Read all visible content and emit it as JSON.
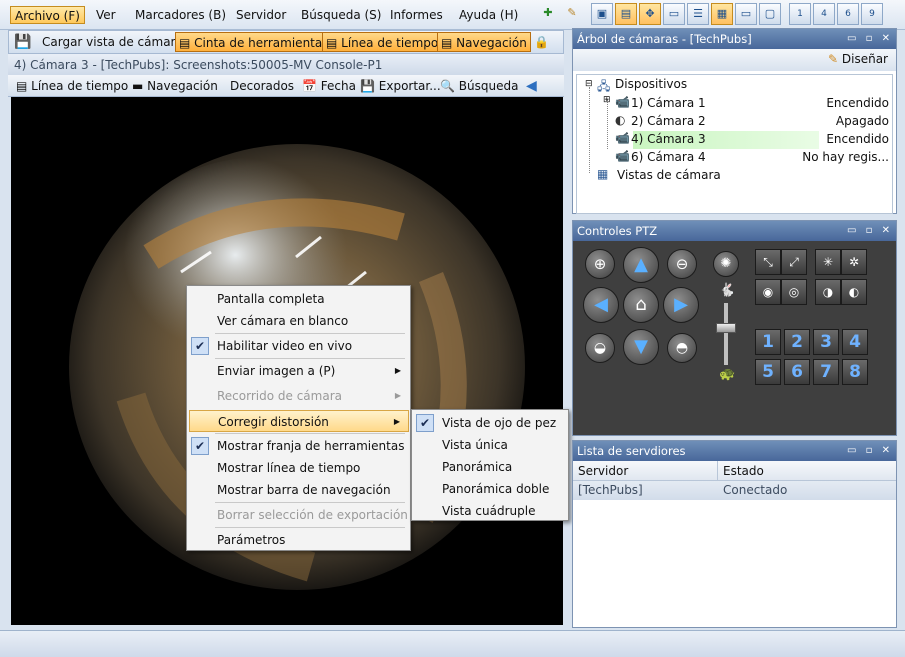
{
  "menubar": {
    "items": [
      "Archivo (F)",
      "Ver",
      "Marcadores (B)",
      "Servidor",
      "Búsqueda (S)",
      "Informes",
      "Ayuda (H)"
    ]
  },
  "toolbar_icons": [
    "add-icon",
    "edit-icon",
    "monitor-icon",
    "layout-grid-icon",
    "move-icon",
    "window-icon",
    "list-icon",
    "layout-active-icon",
    "window-2-icon",
    "window-3-icon",
    "layout-1-icon",
    "layout-4-icon",
    "layout-6-icon",
    "layout-9-icon"
  ],
  "toolbar": {
    "load_view": "Cargar vista de cámara",
    "strip": "Cinta de herramientas",
    "timeline": "Línea de tiempo",
    "navigation": "Navegación"
  },
  "camera_view": {
    "title": "4) Cámara 3 - [TechPubs]: Screenshots:50005-MV Console-P1",
    "toolbar": {
      "timeline": "Línea de tiempo",
      "navigation": "Navegación",
      "decorated": "Decorados",
      "date": "Fecha",
      "export": "Exportar...",
      "search": "Búsqueda"
    }
  },
  "context_menu": {
    "items": [
      {
        "label": "Pantalla completa"
      },
      {
        "label": "Ver cámara en blanco"
      },
      {
        "label": "Habilitar video en vivo"
      },
      {
        "label": "Enviar imagen a (P)"
      },
      {
        "label": "Recorrido de cámara"
      },
      {
        "label": "Corregir distorsión"
      },
      {
        "label": "Mostrar franja de herramientas"
      },
      {
        "label": "Mostrar línea de tiempo"
      },
      {
        "label": "Mostrar barra de navegación"
      },
      {
        "label": "Borrar selección de exportación"
      },
      {
        "label": "Parámetros"
      }
    ]
  },
  "submenu": {
    "items": [
      {
        "label": "Vista de ojo de pez"
      },
      {
        "label": "Vista única"
      },
      {
        "label": "Panorámica"
      },
      {
        "label": "Panorámica doble"
      },
      {
        "label": "Vista cuádruple"
      }
    ]
  },
  "camera_tree": {
    "title": "Árbol de cámaras - [TechPubs]",
    "design_button": "Diseñar",
    "root": "Dispositivos",
    "cameras": [
      {
        "name": "1) Cámara 1",
        "status": "Encendido"
      },
      {
        "name": "2) Cámara 2",
        "status": "Apagado"
      },
      {
        "name": "4) Cámara 3",
        "status": "Encendido"
      },
      {
        "name": "6) Cámara 4",
        "status": "No hay regis..."
      }
    ],
    "views": "Vistas de cámara"
  },
  "ptz": {
    "title": "Controles PTZ",
    "presets": [
      "1",
      "2",
      "3",
      "4",
      "5",
      "6",
      "7",
      "8"
    ]
  },
  "servers": {
    "title": "Lista de servdiores",
    "columns": [
      "Servidor",
      "Estado"
    ],
    "rows": [
      {
        "server": "[TechPubs]",
        "status": "Conectado"
      }
    ]
  },
  "colors": {
    "accent": "#ffc95c",
    "panel_header": "#48679a",
    "selected_row": "#c9f5c0"
  }
}
